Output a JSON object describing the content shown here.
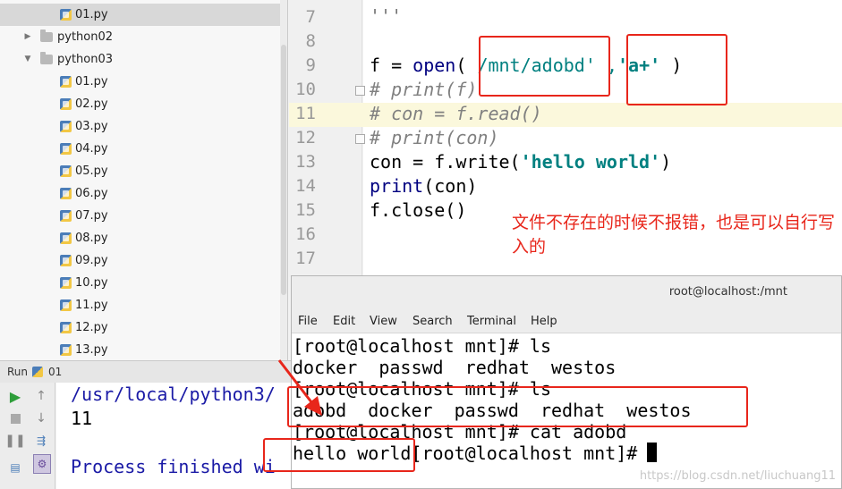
{
  "project_tree": {
    "top_file": "01.py",
    "folders": [
      {
        "name": "python02",
        "expanded": false
      },
      {
        "name": "python03",
        "expanded": true
      }
    ],
    "python03_files": [
      "01.py",
      "02.py",
      "03.py",
      "04.py",
      "05.py",
      "06.py",
      "07.py",
      "08.py",
      "09.py",
      "10.py",
      "11.py",
      "12.py",
      "13.py"
    ]
  },
  "editor": {
    "line_numbers": [
      "7",
      "8",
      "9",
      "10",
      "11",
      "12",
      "13",
      "14",
      "15",
      "16",
      "17"
    ],
    "line7": "'''",
    "line9": {
      "a": "f = ",
      "b": "open",
      "c": "( ",
      "d": "/mnt/adobd",
      "e": "' ,",
      "f": "'a+'",
      "g": " )"
    },
    "line10": "# print(f)",
    "line11": "# con = f.read()",
    "line12": "# print(con)",
    "line13": {
      "a": "con = f.write(",
      "b": "'hello world'",
      "c": ")"
    },
    "line14": {
      "a": "print",
      "b": "(con)"
    },
    "line15": "f.close()"
  },
  "annotation": {
    "note": "文件不存在的时候不报错，也是可以自行写入的"
  },
  "run_panel": {
    "label": "Run",
    "config": "01",
    "console_lines": [
      "/usr/local/python3/",
      "11",
      "",
      "Process finished wi"
    ]
  },
  "terminal": {
    "title": "root@localhost:/mnt",
    "menu": [
      "File",
      "Edit",
      "View",
      "Search",
      "Terminal",
      "Help"
    ],
    "lines": [
      "[root@localhost mnt]# ls",
      "docker  passwd  redhat  westos",
      "[root@localhost mnt]# ls",
      "adobd  docker  passwd  redhat  westos",
      "[root@localhost mnt]# cat adobd",
      "hello world[root@localhost mnt]# "
    ],
    "watermark": "https://blog.csdn.net/liuchuang11"
  },
  "colors": {
    "annotation_red": "#e8261b",
    "string_teal": "#008080",
    "keyword_navy": "#000080"
  }
}
